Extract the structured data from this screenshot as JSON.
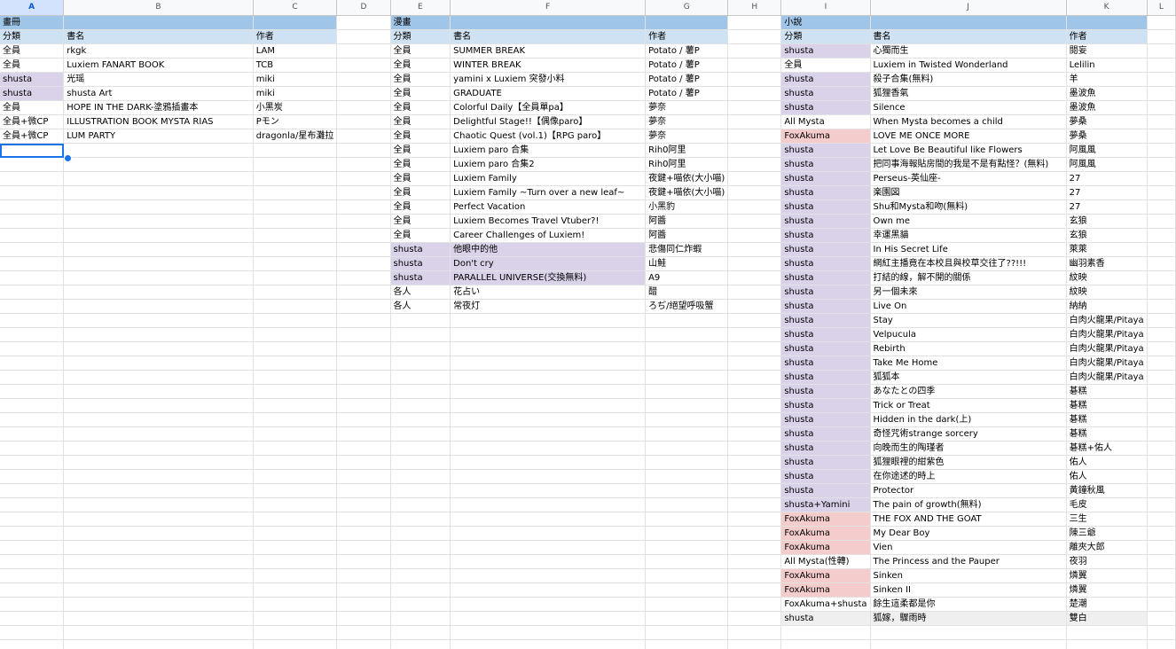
{
  "columns": [
    "A",
    "B",
    "C",
    "D",
    "E",
    "F",
    "G",
    "H",
    "I",
    "J",
    "K",
    "L"
  ],
  "active_column": "A",
  "selected_cell": "A10",
  "colors": {
    "title_band": "#9fc5e8",
    "header_band": "#cfe2f3",
    "shusta": "#d9d2e9",
    "foxakuma": "#f4cccc",
    "selection": "#1a73e8"
  },
  "sections": [
    {
      "title": "畫冊",
      "headers": [
        "分類",
        "書名",
        "作者"
      ],
      "rows": [
        {
          "cat": "全員",
          "title": "rkgk",
          "author": "LAM",
          "tag": ""
        },
        {
          "cat": "全員",
          "title": "Luxiem FANART BOOK",
          "author": "TCB",
          "tag": ""
        },
        {
          "cat": "shusta",
          "title": "光瑶",
          "author": "miki",
          "tag": "shusta"
        },
        {
          "cat": "shusta",
          "title": "shusta Art",
          "author": "miki",
          "tag": "shusta"
        },
        {
          "cat": "全員",
          "title": "HOPE IN THE DARK-塗鴉插畫本",
          "author": "小黑炭",
          "tag": ""
        },
        {
          "cat": "全員+微CP",
          "title": "ILLUSTRATION BOOK MYSTA RIAS",
          "author": "Pモン",
          "tag": ""
        },
        {
          "cat": "全員+微CP",
          "title": "LUM PARTY",
          "author": "dragonla/星布灘拉",
          "tag": ""
        }
      ]
    },
    {
      "title": "漫畫",
      "headers": [
        "分類",
        "書名",
        "作者"
      ],
      "rows": [
        {
          "cat": "全員",
          "title": "SUMMER BREAK",
          "author": "Potato / 薯P",
          "tag": ""
        },
        {
          "cat": "全員",
          "title": "WINTER BREAK",
          "author": "Potato / 薯P",
          "tag": ""
        },
        {
          "cat": "全員",
          "title": "yamini x Luxiem 突發小料",
          "author": "Potato / 薯P",
          "tag": ""
        },
        {
          "cat": "全員",
          "title": "GRADUATE",
          "author": "Potato / 薯P",
          "tag": ""
        },
        {
          "cat": "全員",
          "title": "Colorful Daily【全員單pa】",
          "author": "夢奈",
          "tag": ""
        },
        {
          "cat": "全員",
          "title": "Delightful Stage!!【偶像paro】",
          "author": "夢奈",
          "tag": ""
        },
        {
          "cat": "全員",
          "title": "Chaotic Quest (vol.1)【RPG paro】",
          "author": "夢奈",
          "tag": ""
        },
        {
          "cat": "全員",
          "title": "Luxiem paro 合集",
          "author": "Rih0阿里",
          "tag": ""
        },
        {
          "cat": "全員",
          "title": "Luxiem paro 合集2",
          "author": "Rih0阿里",
          "tag": ""
        },
        {
          "cat": "全員",
          "title": "Luxiem Family",
          "author": "夜鍵+喵依(大小喵)",
          "tag": ""
        },
        {
          "cat": "全員",
          "title": "Luxiem Family ~Turn over a new leaf~",
          "author": "夜鍵+喵依(大小喵)",
          "tag": ""
        },
        {
          "cat": "全員",
          "title": "Perfect Vacation",
          "author": "小黑豹",
          "tag": ""
        },
        {
          "cat": "全員",
          "title": "Luxiem Becomes Travel Vtuber?!",
          "author": "阿醬",
          "tag": ""
        },
        {
          "cat": "全員",
          "title": "Career Challenges of Luxiem!",
          "author": "阿醬",
          "tag": ""
        },
        {
          "cat": "shusta",
          "title": "他眼中的他",
          "author": "悲傷同仁炸蝦",
          "tag": "shusta"
        },
        {
          "cat": "shusta",
          "title": "Don't cry",
          "author": "山鮭",
          "tag": "shusta"
        },
        {
          "cat": "shusta",
          "title": "PARALLEL UNIVERSE(交換無料)",
          "author": "A9",
          "tag": "shusta"
        },
        {
          "cat": "各人",
          "title": "花占い",
          "author": "醋",
          "tag": ""
        },
        {
          "cat": "各人",
          "title": "常夜灯",
          "author": "ろぢ/絕望呼吸蟹",
          "tag": ""
        }
      ]
    },
    {
      "title": "小說",
      "headers": [
        "分類",
        "書名",
        "作者"
      ],
      "rows": [
        {
          "cat": "shusta",
          "title": "心獨而生",
          "author": "閱妄",
          "tag": "shusta"
        },
        {
          "cat": "全員",
          "title": "Luxiem in Twisted Wonderland",
          "author": "Lelilin",
          "tag": ""
        },
        {
          "cat": "shusta",
          "title": "殺子合集(無料)",
          "author": "羊",
          "tag": "shusta"
        },
        {
          "cat": "shusta",
          "title": "狐狸香氣",
          "author": "墨波魚",
          "tag": "shusta"
        },
        {
          "cat": "shusta",
          "title": "Silence",
          "author": "墨波魚",
          "tag": "shusta"
        },
        {
          "cat": "All Mysta",
          "title": "When Mysta becomes a child",
          "author": "夢桑",
          "tag": ""
        },
        {
          "cat": "FoxAkuma",
          "title": "LOVE ME ONCE MORE",
          "author": "夢桑",
          "tag": "fox"
        },
        {
          "cat": "shusta",
          "title": "Let Love Be Beautiful like Flowers",
          "author": "阿風風",
          "tag": "shusta"
        },
        {
          "cat": "shusta",
          "title": "把同事海報貼房間的我是不是有點怪？(無料)",
          "author": "阿風風",
          "tag": "shusta"
        },
        {
          "cat": "shusta",
          "title": "Perseus-英仙座-",
          "author": "27",
          "tag": "shusta"
        },
        {
          "cat": "shusta",
          "title": "楽園図",
          "author": "27",
          "tag": "shusta"
        },
        {
          "cat": "shusta",
          "title": "Shu和Mysta和吻(無料)",
          "author": "27",
          "tag": "shusta"
        },
        {
          "cat": "shusta",
          "title": "Own me",
          "author": "玄狼",
          "tag": "shusta"
        },
        {
          "cat": "shusta",
          "title": "幸運黑貓",
          "author": "玄狼",
          "tag": "shusta"
        },
        {
          "cat": "shusta",
          "title": "In His Secret Life",
          "author": "萊萊",
          "tag": "shusta"
        },
        {
          "cat": "shusta",
          "title": "網紅主播竟在本校且與校草交往了??!!!",
          "author": "幽羽素香",
          "tag": "shusta"
        },
        {
          "cat": "shusta",
          "title": "打結的線，解不開的關係",
          "author": "紋映",
          "tag": "shusta"
        },
        {
          "cat": "shusta",
          "title": "另一個未來",
          "author": "紋映",
          "tag": "shusta"
        },
        {
          "cat": "shusta",
          "title": "Live On",
          "author": "納納",
          "tag": "shusta"
        },
        {
          "cat": "shusta",
          "title": "Stay",
          "author": "白肉火龍果/Pitaya",
          "tag": "shusta"
        },
        {
          "cat": "shusta",
          "title": "Velpucula",
          "author": "白肉火龍果/Pitaya",
          "tag": "shusta"
        },
        {
          "cat": "shusta",
          "title": "Rebirth",
          "author": "白肉火龍果/Pitaya",
          "tag": "shusta"
        },
        {
          "cat": "shusta",
          "title": "Take Me Home",
          "author": "白肉火龍果/Pitaya",
          "tag": "shusta"
        },
        {
          "cat": "shusta",
          "title": "狐狐本",
          "author": "白肉火龍果/Pitaya",
          "tag": "shusta"
        },
        {
          "cat": "shusta",
          "title": "あなたとの四季",
          "author": "碁糕",
          "tag": "shusta"
        },
        {
          "cat": "shusta",
          "title": "Trick or Treat",
          "author": "碁糕",
          "tag": "shusta"
        },
        {
          "cat": "shusta",
          "title": "Hidden in the dark(上)",
          "author": "碁糕",
          "tag": "shusta"
        },
        {
          "cat": "shusta",
          "title": "奇怪咒術strange sorcery",
          "author": "碁糕",
          "tag": "shusta"
        },
        {
          "cat": "shusta",
          "title": "向晚而生的陶瑾者",
          "author": "碁糕+佑人",
          "tag": "shusta"
        },
        {
          "cat": "shusta",
          "title": "狐狸眼裡的紺紫色",
          "author": "佑人",
          "tag": "shusta"
        },
        {
          "cat": "shusta",
          "title": "在你途述的時上",
          "author": "佑人",
          "tag": "shusta"
        },
        {
          "cat": "shusta",
          "title": "Protector",
          "author": "黃鐘秋風",
          "tag": "shusta"
        },
        {
          "cat": "shusta+Yamini",
          "title": "The pain of growth(無料)",
          "author": "毛皮",
          "tag": "shusta"
        },
        {
          "cat": "FoxAkuma",
          "title": "THE FOX AND THE GOAT",
          "author": "三生",
          "tag": "fox"
        },
        {
          "cat": "FoxAkuma",
          "title": "My Dear Boy",
          "author": "陳三爺",
          "tag": "fox"
        },
        {
          "cat": "FoxAkuma",
          "title": "Vien",
          "author": "離夾大郎",
          "tag": "fox"
        },
        {
          "cat": "All Mysta(性轉)",
          "title": "The Princess and the Pauper",
          "author": "夜羽",
          "tag": ""
        },
        {
          "cat": "FoxAkuma",
          "title": "Sinken",
          "author": "燐翼",
          "tag": "fox"
        },
        {
          "cat": "FoxAkuma",
          "title": "Sinken II",
          "author": "燐翼",
          "tag": "fox"
        },
        {
          "cat": "FoxAkuma+shusta",
          "title": "餘生這柔都是你",
          "author": "楚潮",
          "tag": ""
        },
        {
          "cat": "shusta",
          "title": "狐嫁，驟雨時",
          "author": "雙白",
          "tag": "grey"
        }
      ]
    }
  ]
}
